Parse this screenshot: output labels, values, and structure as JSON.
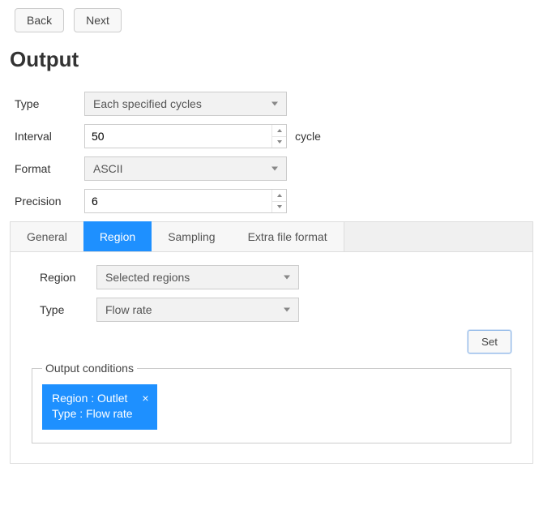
{
  "nav": {
    "back": "Back",
    "next": "Next"
  },
  "heading": "Output",
  "fields": {
    "type": {
      "label": "Type",
      "value": "Each specified cycles"
    },
    "interval": {
      "label": "Interval",
      "value": "50",
      "unit": "cycle"
    },
    "format": {
      "label": "Format",
      "value": "ASCII"
    },
    "precision": {
      "label": "Precision",
      "value": "6"
    }
  },
  "tabs": {
    "general": "General",
    "region": "Region",
    "sampling": "Sampling",
    "extra": "Extra file format"
  },
  "regionTab": {
    "region": {
      "label": "Region",
      "value": "Selected regions"
    },
    "type": {
      "label": "Type",
      "value": "Flow rate"
    },
    "set": "Set",
    "legend": "Output conditions",
    "chip": {
      "line1": "Region : Outlet",
      "line2": "Type : Flow rate",
      "close": "×"
    }
  }
}
